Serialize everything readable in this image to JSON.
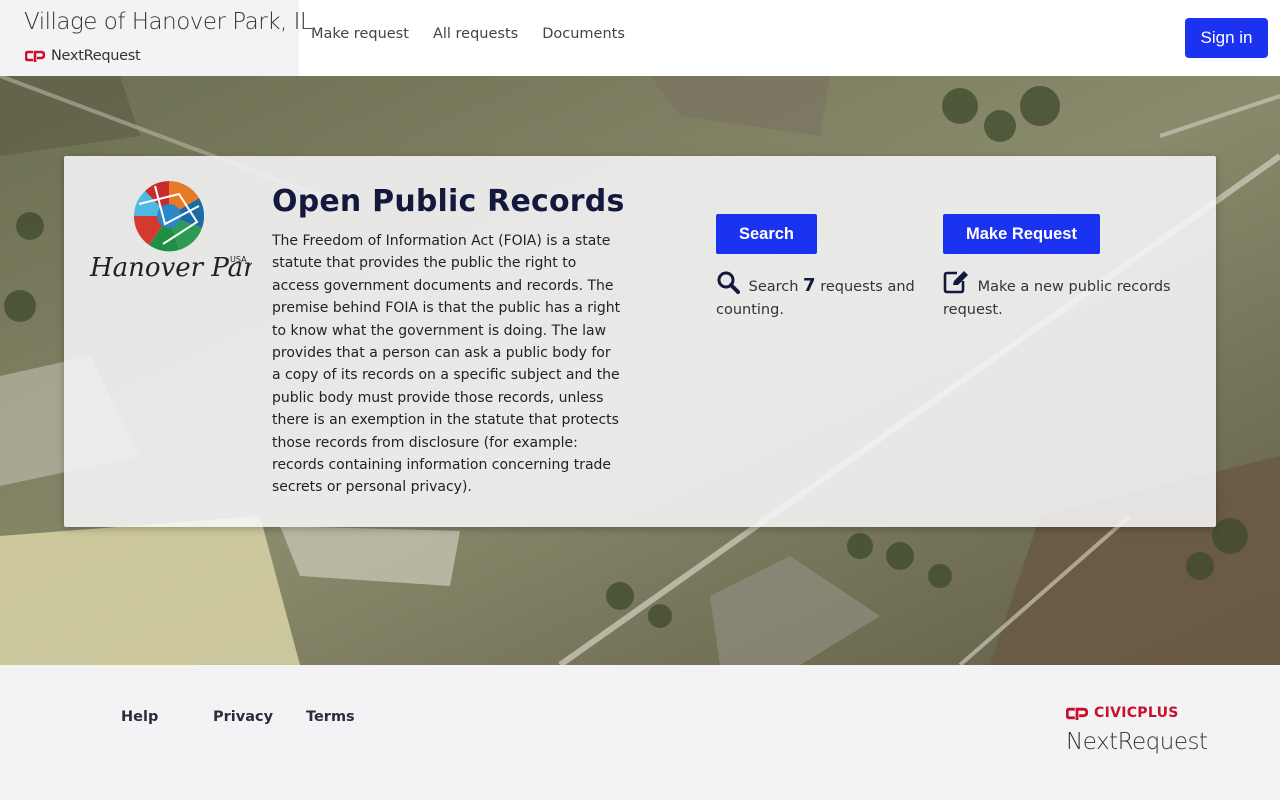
{
  "header": {
    "site_title": "Village of Hanover Park, IL",
    "brand_name": "NextRequest",
    "nav": [
      "Make request",
      "All requests",
      "Documents"
    ],
    "signin_label": "Sign in"
  },
  "hero": {
    "logo_text": "Hanover Park",
    "logo_suffix": "USA",
    "title": "Open Public Records",
    "description": "The Freedom of Information Act (FOIA) is a state statute that provides the public the right to access government documents and records. The premise behind FOIA is that the public has a right to know what the government is doing. The law provides that a person can ask a public body for a copy of its records on a specific subject and the public body must provide those records, unless there is an exemption in the statute that protects those records from disclosure (for example: records containing information concerning trade secrets or personal privacy).",
    "search_button": "Search",
    "search_prefix": "Search",
    "request_count": "7",
    "search_suffix": "requests and counting.",
    "make_button": "Make Request",
    "make_text": "Make a new public records request."
  },
  "footer": {
    "links": [
      "Help",
      "Privacy",
      "Terms"
    ],
    "civic_brand": "CIVICPLUS",
    "product": "NextRequest"
  },
  "colors": {
    "primary": "#1b33f0",
    "heading": "#13193c",
    "civic_red": "#c8102e"
  }
}
